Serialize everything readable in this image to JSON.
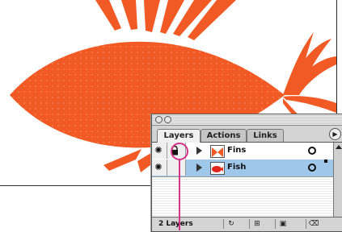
{
  "colors": {
    "fish_orange": "#f15a24",
    "selected_row": "#9ec7ea",
    "callout_magenta": "#d6338a"
  },
  "panel": {
    "tabs": [
      {
        "label": "Layers",
        "active": true
      },
      {
        "label": "Actions",
        "active": false
      },
      {
        "label": "Links",
        "active": false
      }
    ],
    "layers": [
      {
        "name": "Fins",
        "visible": true,
        "locked": true,
        "selected": false,
        "thumbnail_icon": "fins-thumbnail-icon"
      },
      {
        "name": "Fish",
        "visible": true,
        "locked": false,
        "selected": true,
        "thumbnail_icon": "fish-thumbnail-icon"
      }
    ],
    "footer": {
      "layer_count": "2 Layers",
      "buttons": [
        "new-sublayer-icon",
        "new-layer-icon",
        "move-layer-icon",
        "trash-icon"
      ]
    }
  }
}
